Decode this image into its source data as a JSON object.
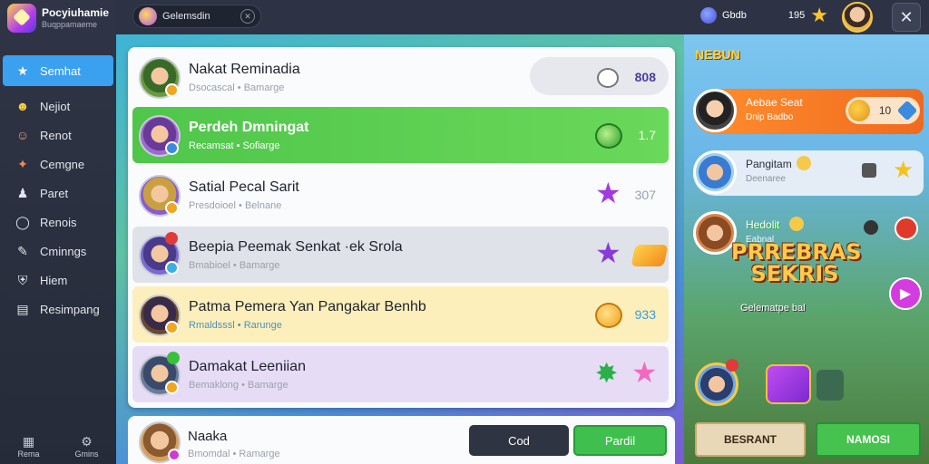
{
  "app": {
    "title": "Pocyiuhamie",
    "subtitle": "Buqppamaeme"
  },
  "sidebar": {
    "items": [
      {
        "label": "Semhat",
        "icon": "star-icon",
        "active": true
      },
      {
        "label": "Nejiot",
        "icon": "smile-icon"
      },
      {
        "label": "Renot",
        "icon": "face-icon"
      },
      {
        "label": "Cemgne",
        "icon": "people-icon"
      },
      {
        "label": "Paret",
        "icon": "user-icon"
      },
      {
        "label": "Renois",
        "icon": "chat-icon"
      },
      {
        "label": "Cminngs",
        "icon": "settings-icon"
      },
      {
        "label": "Hiem",
        "icon": "shield-icon"
      },
      {
        "label": "Resimpang",
        "icon": "calendar-icon"
      }
    ],
    "bottom": [
      {
        "label": "Rema",
        "icon": "grid-icon"
      },
      {
        "label": "Gmins",
        "icon": "gear-icon"
      }
    ]
  },
  "topbar": {
    "search_value": "Gelemsdin",
    "currency_label": "Gbdb",
    "currency_value": "195"
  },
  "list": {
    "rows": [
      {
        "title": "Nakat Reminadia",
        "sub": "Dsocascal • Bamarge",
        "score": "808"
      },
      {
        "title": "Perdeh Dmningat",
        "sub": "Recamsat • Sofiarge",
        "score": "1.7"
      },
      {
        "title": "Satial Pecal Sarit",
        "sub": "Presdoioel • Belnane",
        "score": "307"
      },
      {
        "title": "Beepia Peemak Senkat ·ek Srola",
        "sub": "Bmabioel • Bamarge",
        "score": ""
      },
      {
        "title": "Patma Pemera Yan Pangakar Benhb",
        "sub": "Rmaldsssl • Rarunge",
        "score": "933"
      },
      {
        "title": "Damakat Leeniian",
        "sub": "Bemaklong • Bamarge",
        "score": ""
      }
    ],
    "solo": {
      "title": "Naaka",
      "sub": "Bmomdal • Ramarge"
    },
    "buttons": {
      "dark": "Cod",
      "green": "Pardil"
    }
  },
  "right_panel": {
    "header": "NEBUN",
    "leaders": [
      {
        "name": "Aebae Seat",
        "sub": "Dnip Badbo",
        "points": "10"
      },
      {
        "name": "Pangitam",
        "sub": "Deenaree"
      },
      {
        "name": "Hedolit",
        "sub": "Eabnal"
      }
    ],
    "game_title": "PRREBRAS SEKRIS",
    "game_sub": "Gelematpe bal",
    "btn_left": "BESRANT",
    "btn_right": "NAMOSI"
  },
  "colors": {
    "accent": "#3aa0f0",
    "green_row": "#4fc64a",
    "yellow_row": "#fdefbb",
    "purple_row": "#e7dcf6",
    "orange_leader": "#ff8f2e"
  }
}
